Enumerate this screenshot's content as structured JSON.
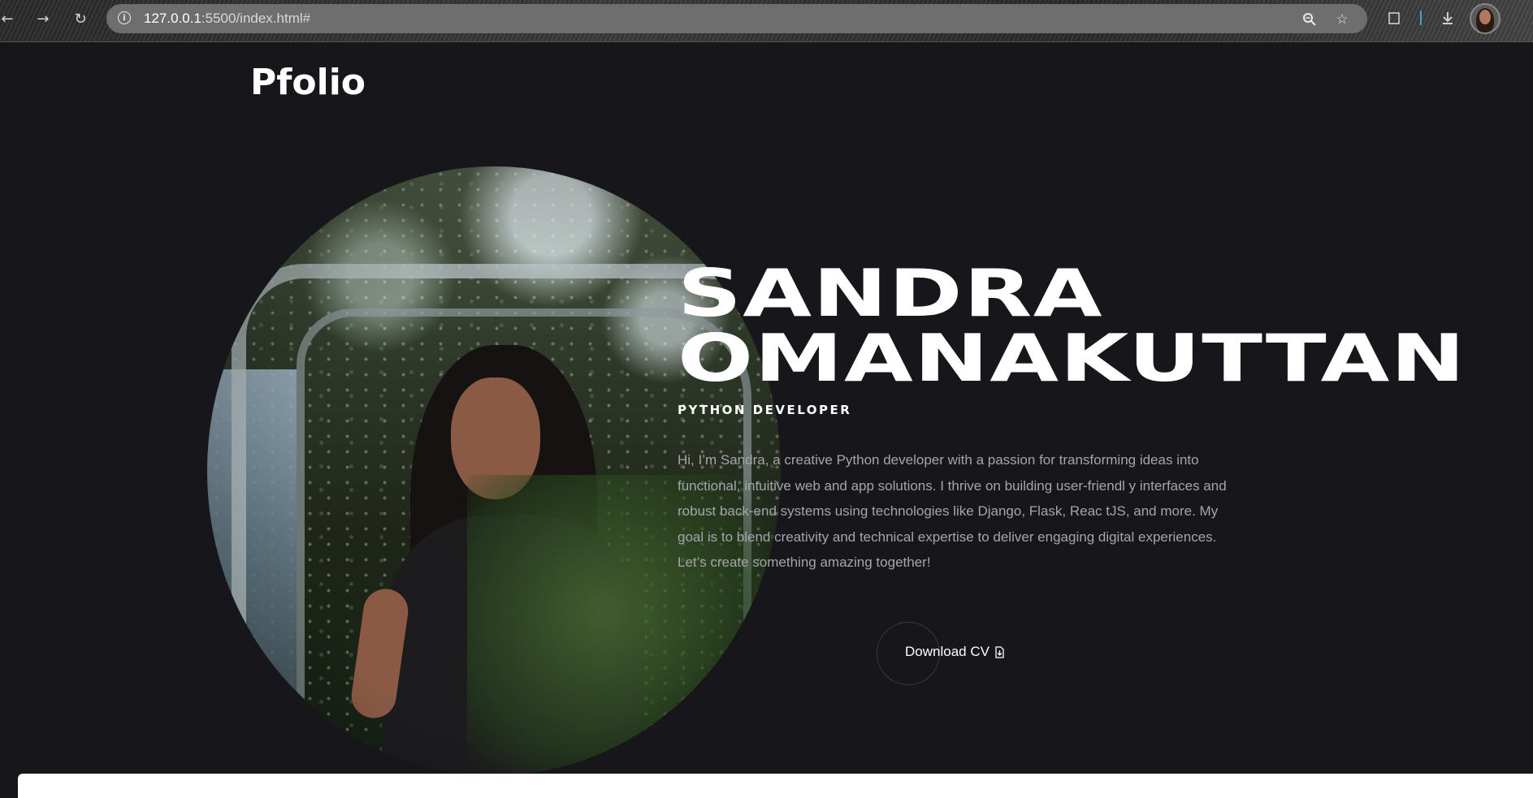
{
  "browser": {
    "url_host": "127.0.0.1",
    "url_rest": ":5500/index.html#",
    "icons": {
      "back": "arrow-left-icon",
      "forward": "arrow-right-icon",
      "reload": "reload-icon",
      "site_info": "info-icon",
      "zoom": "zoom-icon",
      "bookmark": "star-icon",
      "extensions": "puzzle-icon",
      "downloads": "download-icon",
      "profile": "avatar"
    }
  },
  "site": {
    "logo": "Pfolio"
  },
  "hero": {
    "name_line1": "SANDRA",
    "name_line2": "OMANAKUTTAN",
    "role": "PYTHON DEVELOPER",
    "bio": "Hi, I’m Sandra, a creative Python developer with a passion for transforming ideas into functional, intuitive web and app solutions. I thrive on building user-friendl y interfaces and robust back-end systems using technologies like Django, Flask, Reac tJS, and more. My goal is to blend creativity and technical expertise to deliver engaging digital experiences. Let’s create something amazing together!",
    "cta_label": "Download CV",
    "cta_icon": "download-file-icon",
    "photo_alt": "portrait-photo"
  },
  "colors": {
    "background": "#17171b",
    "text": "#ffffff",
    "muted_text": "#a4a4ab"
  }
}
